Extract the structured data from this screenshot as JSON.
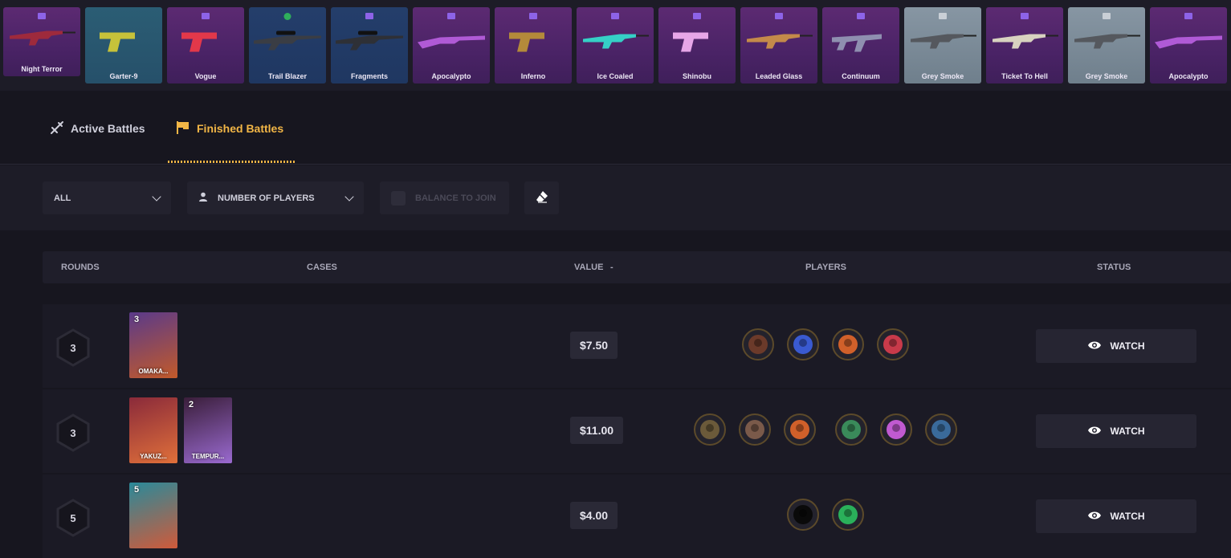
{
  "feed": {
    "items": [
      {
        "name": "Night Terror",
        "tier": "purple",
        "tag": "case",
        "gun": "rifle",
        "color": "#9e2a3c"
      },
      {
        "name": "Garter-9",
        "tier": "teal",
        "tag": "none",
        "gun": "pistol",
        "color": "#c6c23a"
      },
      {
        "name": "Vogue",
        "tier": "purple",
        "tag": "case",
        "gun": "pistol",
        "color": "#e2384a"
      },
      {
        "name": "Trail Blazer",
        "tier": "blue",
        "tag": "round",
        "gun": "sniper",
        "color": "#3a3d44"
      },
      {
        "name": "Fragments",
        "tier": "blue",
        "tag": "case",
        "gun": "sniper",
        "color": "#2e3036"
      },
      {
        "name": "Apocalypto",
        "tier": "purple",
        "tag": "case",
        "gun": "shotgun",
        "color": "#b05ad6"
      },
      {
        "name": "Inferno",
        "tier": "purple",
        "tag": "case",
        "gun": "pistol",
        "color": "#b48a3a"
      },
      {
        "name": "Ice Coaled",
        "tier": "purple",
        "tag": "case",
        "gun": "rifle",
        "color": "#35d0c6"
      },
      {
        "name": "Shinobu",
        "tier": "purple",
        "tag": "case",
        "gun": "pistol",
        "color": "#e7a6e8"
      },
      {
        "name": "Leaded Glass",
        "tier": "purple",
        "tag": "case",
        "gun": "rifle",
        "color": "#c48a4a"
      },
      {
        "name": "Continuum",
        "tier": "purple",
        "tag": "case",
        "gun": "smg",
        "color": "#8f8fb0"
      },
      {
        "name": "Grey Smoke",
        "tier": "grey",
        "tag": "case",
        "gun": "rifle",
        "color": "#55585e"
      },
      {
        "name": "Ticket To Hell",
        "tier": "purple",
        "tag": "case",
        "gun": "rifle",
        "color": "#d8d2c0"
      },
      {
        "name": "Grey Smoke",
        "tier": "grey",
        "tag": "case",
        "gun": "rifle",
        "color": "#55585e"
      },
      {
        "name": "Apocalypto",
        "tier": "purple",
        "tag": "case",
        "gun": "shotgun",
        "color": "#b05ad6"
      }
    ]
  },
  "tabs": {
    "active": "Active Battles",
    "finished": "Finished Battles",
    "active_icon": "swords-icon",
    "finished_icon": "flag-icon"
  },
  "filters": {
    "mode": "ALL",
    "players": "NUMBER OF PLAYERS",
    "balance": "BALANCE TO JOIN",
    "players_icon": "user-icon",
    "clear_icon": "eraser-icon"
  },
  "table": {
    "headers": {
      "rounds": "ROUNDS",
      "cases": "CASES",
      "value": "VALUE",
      "value_sort": "-",
      "players": "PLAYERS",
      "status": "STATUS"
    },
    "rows": [
      {
        "rounds": "3",
        "value": "$7.50",
        "action": "WATCH",
        "cases": [
          {
            "qty": "3",
            "name": "OMAKA...",
            "colors": [
              "#5a3a8a",
              "#c25a2a"
            ]
          }
        ],
        "players": [
          {
            "icon": "soldier-avatar",
            "color": "#6b3a2a"
          },
          {
            "icon": "wolf-avatar",
            "color": "#3a5ad0"
          },
          {
            "icon": "monkey-avatar",
            "color": "#d0602a"
          },
          {
            "icon": "book-avatar",
            "color": "#c83a4a"
          }
        ]
      },
      {
        "rounds": "3",
        "value": "$11.00",
        "action": "WATCH",
        "cases": [
          {
            "qty": "",
            "name": "YAKUZ...",
            "colors": [
              "#8a2a3a",
              "#e0703a"
            ]
          },
          {
            "qty": "2",
            "name": "TEMPUR...",
            "colors": [
              "#3a1e3a",
              "#9a6ad0"
            ]
          }
        ],
        "players": [
          {
            "icon": "soldier-avatar",
            "color": "#6b5a3a"
          },
          {
            "icon": "case-avatar",
            "color": "#7a5a4a"
          },
          {
            "icon": "monkey-avatar",
            "color": "#d0602a"
          },
          {
            "icon": "card-avatar",
            "color": "#3a8a5a"
          },
          {
            "icon": "bear-avatar",
            "color": "#c05ad0"
          },
          {
            "icon": "screen-avatar",
            "color": "#3a6a9a"
          }
        ]
      },
      {
        "rounds": "5",
        "value": "$4.00",
        "action": "WATCH",
        "cases": [
          {
            "qty": "5",
            "name": "",
            "colors": [
              "#2a8a9a",
              "#d05a3a"
            ]
          }
        ],
        "players": [
          {
            "icon": "blank-avatar",
            "color": "#0a0a0a"
          },
          {
            "icon": "bear-avatar",
            "color": "#2ab05a"
          }
        ]
      }
    ]
  },
  "colors": {
    "accent": "#f2b646",
    "background": "#17161f",
    "panel": "#1d1c27"
  }
}
